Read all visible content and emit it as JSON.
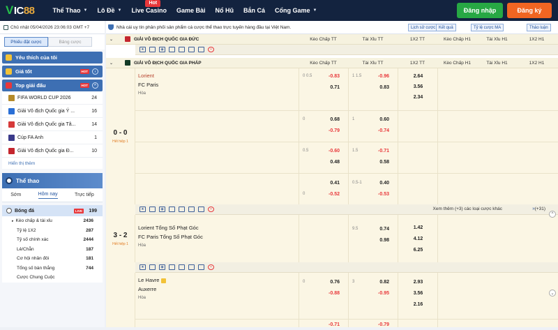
{
  "brand": {
    "v": "V",
    "ic": "IC",
    "num": "88"
  },
  "nav": [
    {
      "label": "Thể Thao",
      "caret": true
    },
    {
      "label": "Lô Đề",
      "caret": true
    },
    {
      "label": "Live Casino",
      "caret": false,
      "badge": "Hot"
    },
    {
      "label": "Game Bài",
      "caret": false
    },
    {
      "label": "Nổ Hũ",
      "caret": false
    },
    {
      "label": "Bắn Cá",
      "caret": false
    },
    {
      "label": "Cổng Game",
      "caret": true
    }
  ],
  "auth": {
    "login": "Đăng nhập",
    "register": "Đăng ký"
  },
  "sidebar": {
    "datetime": "Chủ nhật 05/04/2026 23:06:03 GMT +7",
    "mode_tabs": {
      "active": "Phiếu đặt cược",
      "inactive": "Bảng cược"
    },
    "favorites": "Yêu thích của tôi",
    "best_odds": "Giá tốt",
    "hot_badge": "HOT",
    "top_leagues": "Top giải đấu",
    "leagues": [
      {
        "name": "FIFA WORLD CUP 2026",
        "count": "24",
        "color": "#b48a2a"
      },
      {
        "name": "Giải Vô địch Quốc gia Ý ...",
        "count": "16",
        "color": "#2a6fd6"
      },
      {
        "name": "Giải Vô địch Quốc gia Tâ...",
        "count": "14",
        "color": "#d63a3a"
      },
      {
        "name": "Cúp FA Anh",
        "count": "1",
        "color": "#3a3a8a"
      },
      {
        "name": "Giải Vô địch Quốc gia Đ...",
        "count": "10",
        "color": "#c4262e"
      }
    ],
    "show_all": "Hiển thị thêm",
    "sports": "Thể thao",
    "time_tabs": [
      "Sớm",
      "Hôm nay",
      "Trực tiếp"
    ],
    "football": {
      "label": "Bóng đá",
      "live": "LIVE",
      "count": "199"
    },
    "bet_types": [
      {
        "label": "Kèo chấp & tài xỉu",
        "count": "2436"
      },
      {
        "label": "Tỷ lệ 1X2",
        "count": "287"
      },
      {
        "label": "Tỷ số chính xác",
        "count": "2444"
      },
      {
        "label": "Lẻ/Chẵn",
        "count": "187"
      },
      {
        "label": "Cơ hội nhân đôi",
        "count": "181"
      },
      {
        "label": "Tổng số bàn thắng",
        "count": "744"
      },
      {
        "label": "Cược Chung Cuộc",
        "count": ""
      }
    ]
  },
  "ticker": {
    "text": "Nhà cái uy tín phân phối sản phẩm cá cược thể thao trực tuyến hàng đầu tại Việt Nam.",
    "buttons": [
      "Lịch sử cược",
      "Kết quả",
      "Tỷ lệ cược MA",
      "Thảo luận"
    ]
  },
  "columns": [
    "Kèo Chấp TT",
    "Tài Xỉu TT",
    "1X2 TT",
    "Kèo Chấp H1",
    "Tài Xỉu H1",
    "1X2 H1"
  ],
  "leagues": {
    "germany": "GIẢI VÔ ĐỊCH QUỐC GIA ĐỨC",
    "france": "GIẢI VÔ ĐỊCH QUỐC GIA PHÁP"
  },
  "match1": {
    "home": "Lorient",
    "away": "FC Paris",
    "draw": "Hòa",
    "score": "0 - 0",
    "status": "Hết hiệp 1",
    "rows": [
      {
        "hh": "0 0.5",
        "ha": "-0.83",
        "hb": "0.71",
        "th": "1 1.5",
        "ta": "-0.96",
        "tb": "0.83",
        "x": [
          "2.64",
          "3.56",
          "2.34"
        ]
      },
      {
        "hh": "0",
        "ha": "0.68",
        "hb": "-0.79",
        "th": "1",
        "ta": "0.60",
        "tb": "-0.74"
      },
      {
        "hh": "0.5",
        "ha": "-0.60",
        "hb": "0.48",
        "th": "1.5",
        "ta": "-0.71",
        "tb": "0.58"
      },
      {
        "hh": "0",
        "ha": "0.41",
        "hb": "-0.52",
        "th": "0.5-1",
        "ta": "0.40",
        "tb": "-0.53"
      }
    ]
  },
  "more": {
    "label": "Xem thêm (+3) các loại cược khác",
    "count": "(+31)"
  },
  "match2": {
    "home": "Lorient Tổng Số Phạt Góc",
    "away": "FC Paris Tổng Số Phạt Góc",
    "draw": "Hòa",
    "score": "3 - 2",
    "status": "Hết hiệp 1",
    "th": "9.5",
    "ta": "0.74",
    "tb": "0.98",
    "x": [
      "1.42",
      "4.12",
      "6.25"
    ]
  },
  "match3": {
    "home": "Le Havre",
    "away": "Auxerre",
    "draw": "Hòa",
    "hh": "0",
    "ha": "0.76",
    "hb": "-0.88",
    "th": "3",
    "ta": "0.82",
    "tb": "-0.95",
    "x": [
      "2.93",
      "3.56",
      "2.16"
    ],
    "next_ha": "-0.71",
    "next_ta": "-0.79"
  },
  "icons": [
    "star-icon",
    "tv-icon",
    "eye-icon",
    "stats-icon",
    "field-icon",
    "table-icon",
    "chat-icon",
    "fire-icon"
  ]
}
